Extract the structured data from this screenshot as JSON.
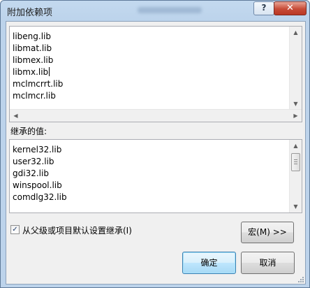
{
  "window": {
    "title": "附加依赖项",
    "help_label": "?",
    "close_label": "✕"
  },
  "dependencies": {
    "items": [
      "libeng.lib",
      "libmat.lib",
      "libmex.lib",
      "libmx.lib",
      "mclmcrrt.lib",
      "mclmcr.lib"
    ]
  },
  "inherited": {
    "label": "继承的值:",
    "items": [
      "kernel32.lib",
      "user32.lib",
      "gdi32.lib",
      "winspool.lib",
      "comdlg32.lib"
    ]
  },
  "inherit_checkbox": {
    "label": "从父级或项目默认设置继承(I)",
    "checked": true
  },
  "buttons": {
    "macro": "宏(M) >>",
    "ok": "确定",
    "cancel": "取消"
  },
  "icons": {
    "up": "scroll-up-arrow",
    "down": "scroll-down-arrow",
    "left": "scroll-left-arrow",
    "right": "scroll-right-arrow",
    "check": "checkmark"
  }
}
